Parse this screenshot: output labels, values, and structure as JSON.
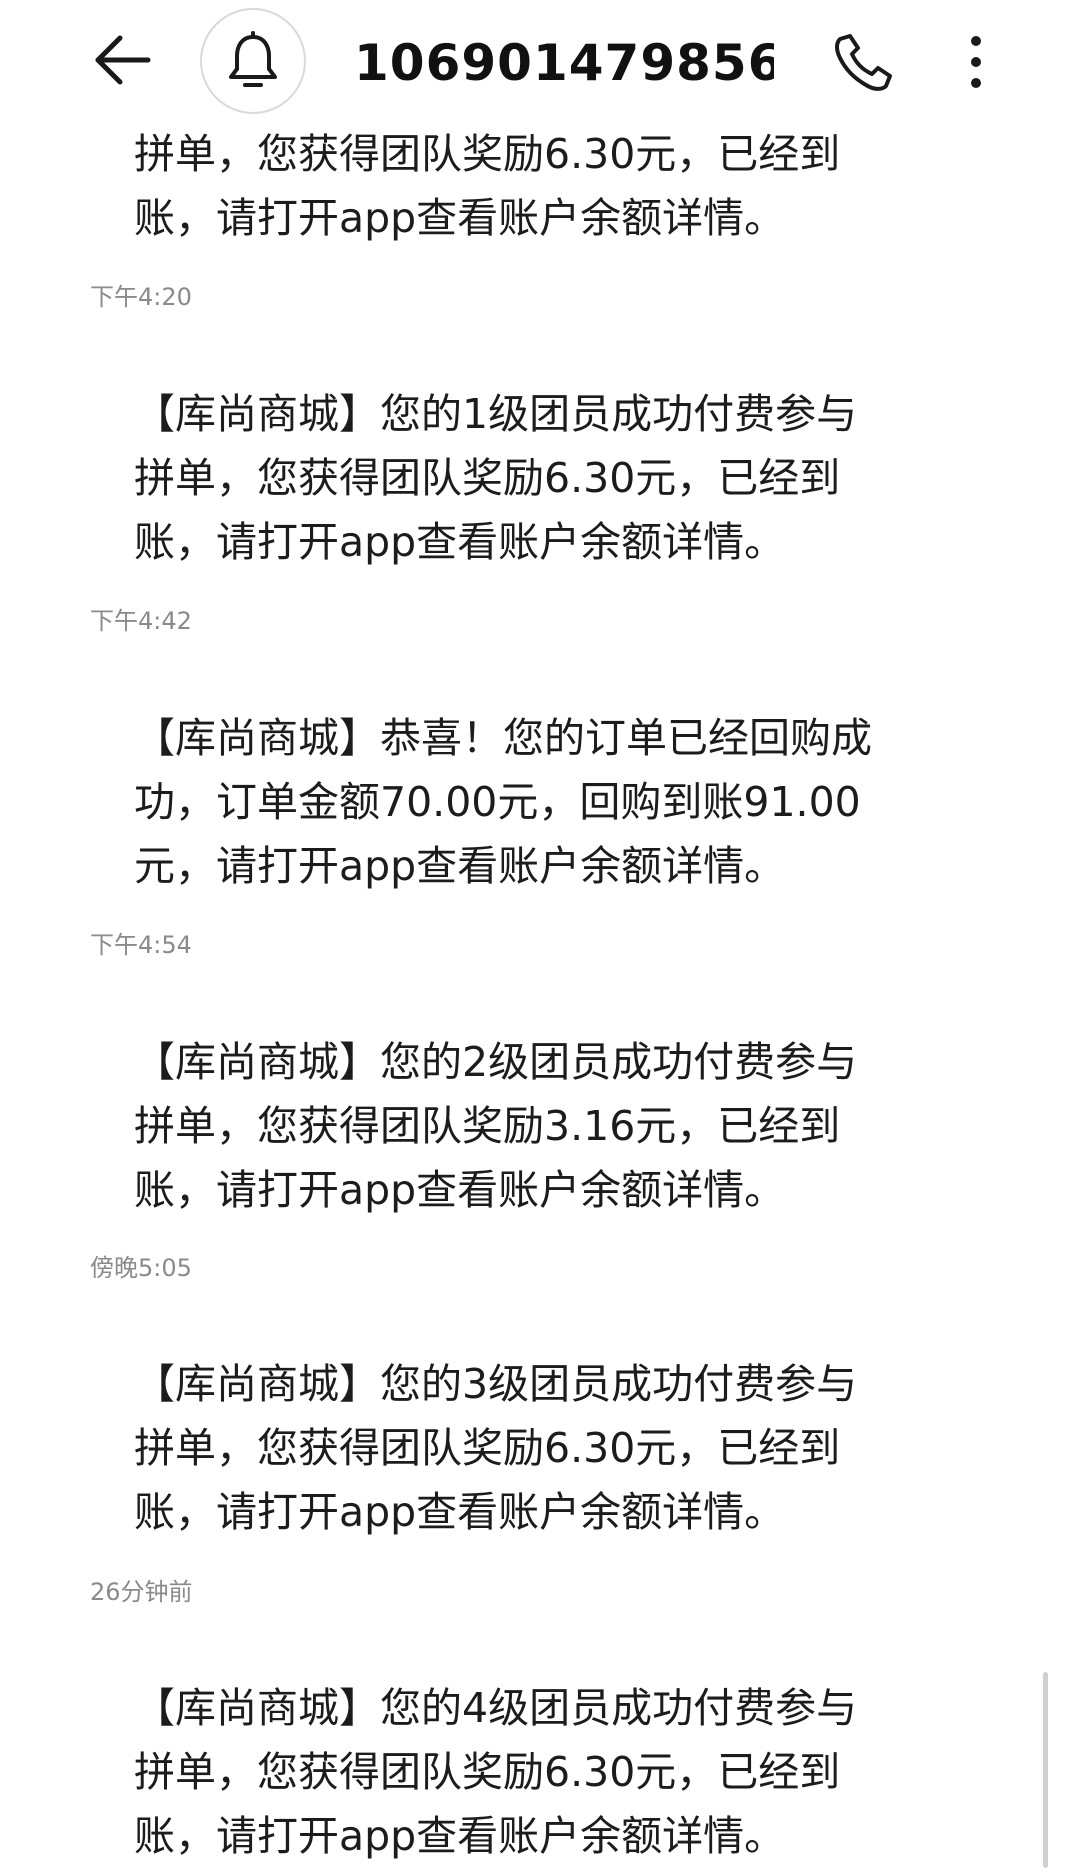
{
  "header": {
    "contact_number": "106901479856...",
    "back_icon": "arrow-left-icon",
    "bell_icon": "bell-icon",
    "call_icon": "phone-icon",
    "more_icon": "more-vertical-icon"
  },
  "messages": [
    {
      "lines": [
        "拼单，您获得团队奖励6.30元，已经到",
        "账，请打开app查看账户余额详情。"
      ],
      "time": "下午4:20"
    },
    {
      "lines": [
        "【库尚商城】您的1级团员成功付费参与",
        "拼单，您获得团队奖励6.30元，已经到",
        "账，请打开app查看账户余额详情。"
      ],
      "time": "下午4:42"
    },
    {
      "lines": [
        "【库尚商城】恭喜！您的订单已经回购成",
        "功，订单金额70.00元，回购到账91.00",
        "元，请打开app查看账户余额详情。"
      ],
      "time": "下午4:54"
    },
    {
      "lines": [
        "【库尚商城】您的2级团员成功付费参与",
        "拼单，您获得团队奖励3.16元，已经到",
        "账，请打开app查看账户余额详情。"
      ],
      "time": "傍晚5:05"
    },
    {
      "lines": [
        "【库尚商城】您的3级团员成功付费参与",
        "拼单，您获得团队奖励6.30元，已经到",
        "账，请打开app查看账户余额详情。"
      ],
      "time": "26分钟前"
    },
    {
      "lines": [
        "【库尚商城】您的4级团员成功付费参与",
        "拼单，您获得团队奖励6.30元，已经到",
        "账，请打开app查看账户余额详情。"
      ]
    }
  ]
}
